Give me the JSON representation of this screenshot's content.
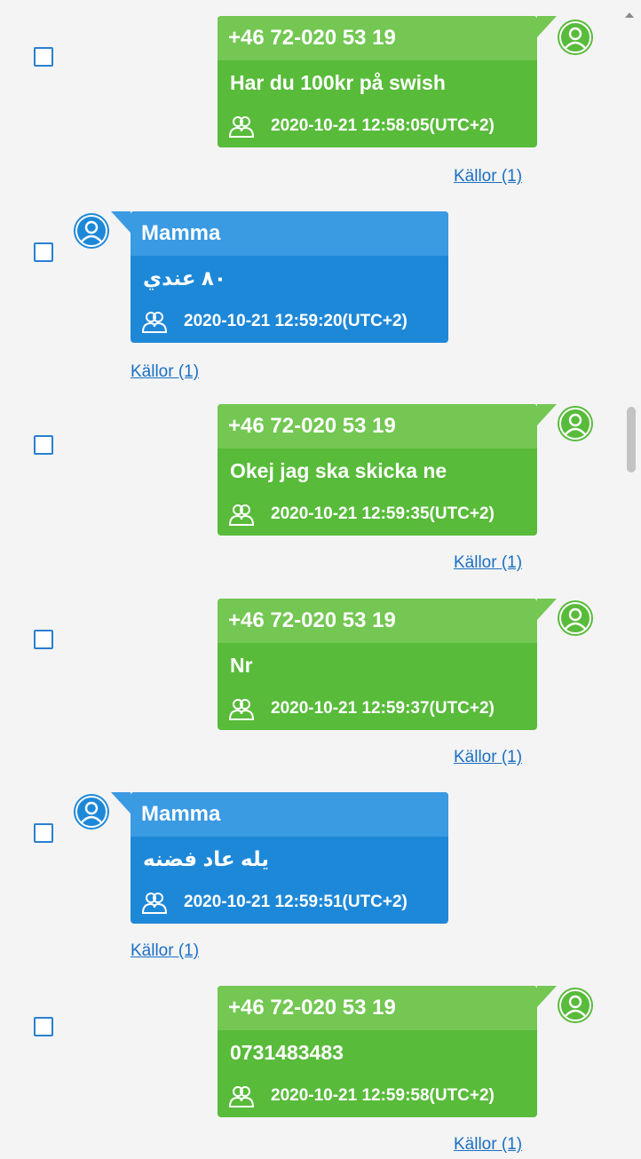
{
  "messages": [
    {
      "sender": "+46 72-020 53 19",
      "text": "Har du 100kr på swish",
      "timestamp": "2020-10-21 12:58:05(UTC+2)",
      "sources": "Källor (1)"
    },
    {
      "sender": "Mamma",
      "text": "٨٠ عندي",
      "timestamp": "2020-10-21 12:59:20(UTC+2)",
      "sources": "Källor (1)"
    },
    {
      "sender": "+46 72-020 53 19",
      "text": "Okej jag ska skicka ne",
      "timestamp": "2020-10-21 12:59:35(UTC+2)",
      "sources": "Källor (1)"
    },
    {
      "sender": "+46 72-020 53 19",
      "text": "Nr",
      "timestamp": "2020-10-21 12:59:37(UTC+2)",
      "sources": "Källor (1)"
    },
    {
      "sender": "Mamma",
      "text": "يله عاد فضنه",
      "timestamp": "2020-10-21 12:59:51(UTC+2)",
      "sources": "Källor (1)"
    },
    {
      "sender": "+46 72-020 53 19",
      "text": "0731483483",
      "timestamp": "2020-10-21 12:59:58(UTC+2)",
      "sources": "Källor (1)"
    }
  ],
  "icons": {
    "avatar": "user-avatar-icon",
    "participants": "participants-icon",
    "scroll_up": "scroll-up-arrow-icon"
  },
  "colors": {
    "outgoing_bubble": "#58bb3a",
    "outgoing_header": "#73c752",
    "incoming_bubble": "#1e88d8",
    "incoming_header": "#3a9ae2",
    "link": "#1a6fc4",
    "checkbox": "#2a7fd1"
  }
}
